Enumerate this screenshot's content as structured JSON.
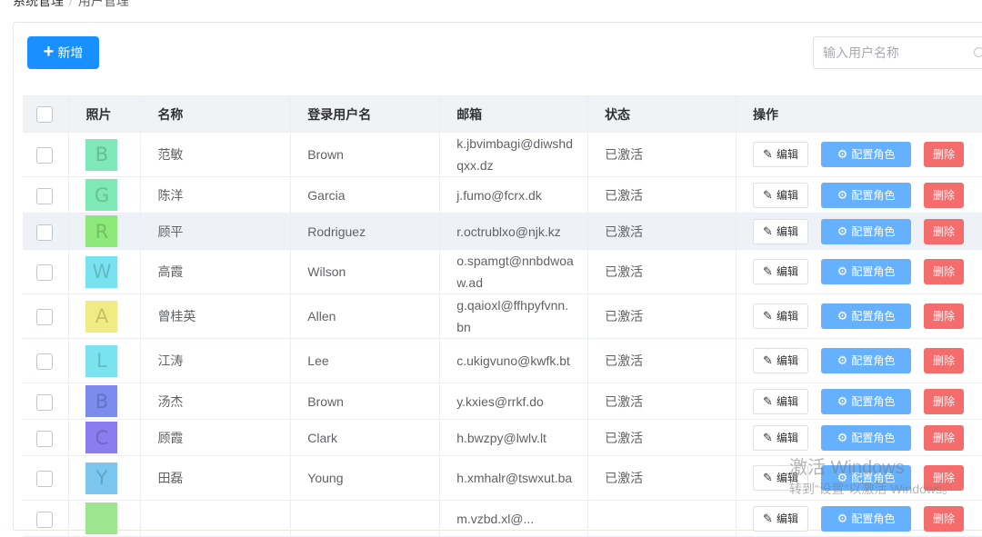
{
  "breadcrumb": {
    "parent": "系统管理",
    "separator": "/",
    "current": "用户管理"
  },
  "toolbar": {
    "add_label": "新增",
    "add_icon": "plus-icon"
  },
  "search": {
    "placeholder": "输入用户名称",
    "value": "",
    "icon": "search-icon"
  },
  "table": {
    "headers": [
      "照片",
      "名称",
      "登录用户名",
      "邮箱",
      "状态",
      "操作"
    ],
    "actions": {
      "edit": "编辑",
      "role": "配置角色",
      "delete": "删除"
    },
    "rows": [
      {
        "avatar_letter": "B",
        "avatar_color": "#7ee8b8",
        "name": "范敏",
        "username": "Brown",
        "email": "k.jbvimbagi@diwshdqxx.dz",
        "status": "已激活"
      },
      {
        "avatar_letter": "G",
        "avatar_color": "#7ee9b5",
        "name": "陈洋",
        "username": "Garcia",
        "email": "j.fumo@fcrx.dk",
        "status": "已激活"
      },
      {
        "avatar_letter": "R",
        "avatar_color": "#8ce97a",
        "name": "顾平",
        "username": "Rodriguez",
        "email": "r.octrublxo@njk.kz",
        "status": "已激活"
      },
      {
        "avatar_letter": "W",
        "avatar_color": "#79e2f0",
        "name": "高霞",
        "username": "Wilson",
        "email": "o.spamgt@nnbdwoaw.ad",
        "status": "已激活"
      },
      {
        "avatar_letter": "A",
        "avatar_color": "#f2ea82",
        "name": "曾桂英",
        "username": "Allen",
        "email": "g.qaioxl@ffhpyfvnn.bn",
        "status": "已激活"
      },
      {
        "avatar_letter": "L",
        "avatar_color": "#7ae3ef",
        "name": "江涛",
        "username": "Lee",
        "email": "c.ukigvuno@kwfk.bt",
        "status": "已激活"
      },
      {
        "avatar_letter": "B",
        "avatar_color": "#7b8cee",
        "name": "汤杰",
        "username": "Brown",
        "email": "y.kxies@rrkf.do",
        "status": "已激活"
      },
      {
        "avatar_letter": "C",
        "avatar_color": "#8d7cf0",
        "name": "顾霞",
        "username": "Clark",
        "email": "h.bwzpy@lwlv.lt",
        "status": "已激活"
      },
      {
        "avatar_letter": "Y",
        "avatar_color": "#7bc6ef",
        "name": "田磊",
        "username": "Young",
        "email": "h.xmhalr@tswxut.ba",
        "status": "已激活"
      },
      {
        "avatar_letter": "",
        "avatar_color": "#9ee58f",
        "name": "",
        "username": "",
        "email": "m.vzbd.xl@...",
        "status": ""
      }
    ]
  },
  "watermark": {
    "line1": "激活 Windows",
    "line2": "转到“设置”以激活 Windows。"
  },
  "colors": {
    "primary": "#1890ff",
    "role": "#66b1ff",
    "danger": "#f56c6c",
    "header_bg": "#f0f2f5"
  }
}
